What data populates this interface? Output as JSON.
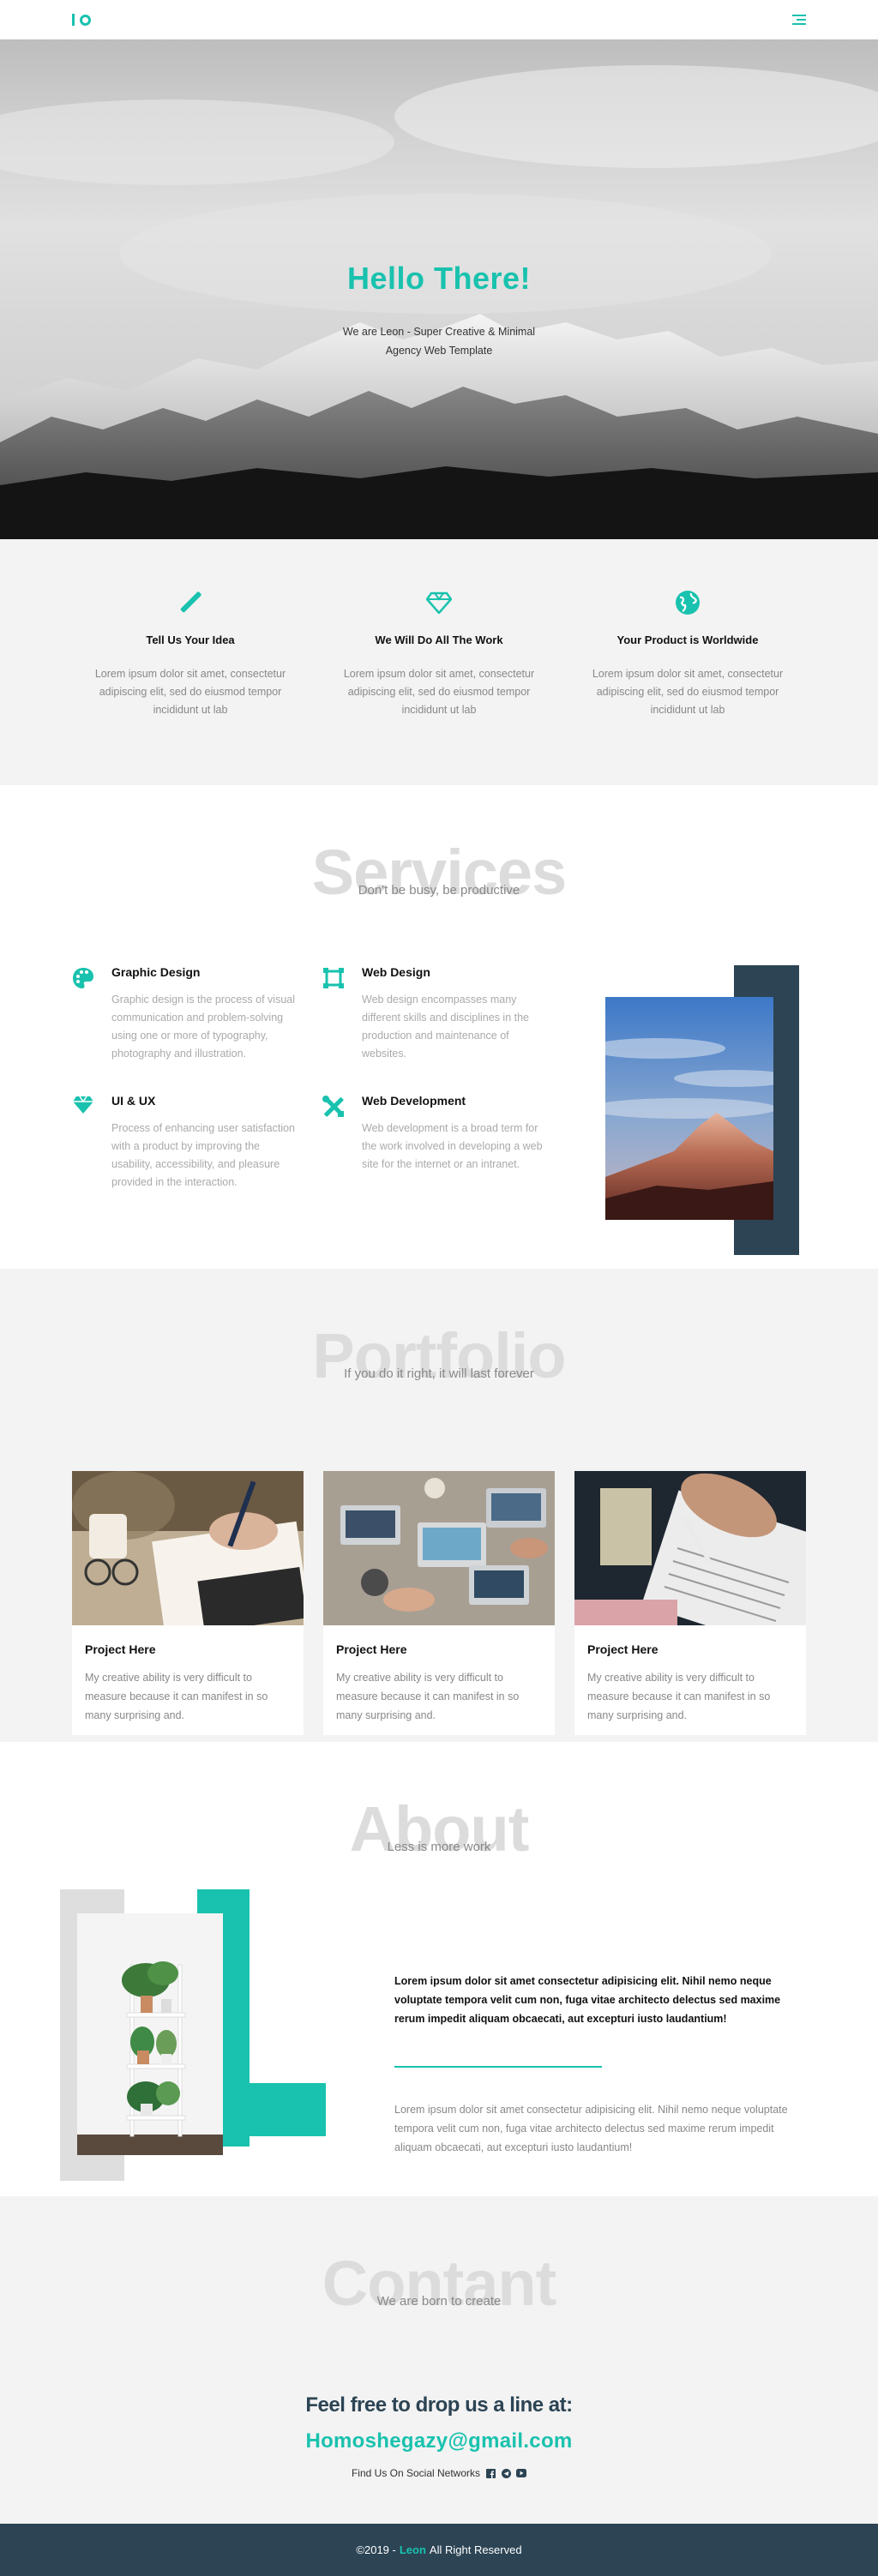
{
  "nav": {
    "logo_label": "IO"
  },
  "hero": {
    "title": "Hello There!",
    "subtitle": "We are Leon - Super Creative & Minimal Agency Web Template"
  },
  "features": [
    {
      "icon": "pen-icon",
      "title": "Tell Us Your Idea",
      "text": "Lorem ipsum dolor sit amet, consectetur adipiscing elit, sed do eiusmod tempor incididunt ut lab"
    },
    {
      "icon": "diamond-icon",
      "title": "We Will Do All The Work",
      "text": "Lorem ipsum dolor sit amet, consectetur adipiscing elit, sed do eiusmod tempor incididunt ut lab"
    },
    {
      "icon": "globe-icon",
      "title": "Your Product is Worldwide",
      "text": "Lorem ipsum dolor sit amet, consectetur adipiscing elit, sed do eiusmod tempor incididunt ut lab"
    }
  ],
  "services": {
    "heading": "Services",
    "subheading": "Don't be busy, be productive",
    "items": [
      {
        "icon": "palette-icon",
        "title": "Graphic Design",
        "text": "Graphic design is the process of visual communication and problem-solving using one or more of typography, photography and illustration."
      },
      {
        "icon": "crop-frame-icon",
        "title": "Web Design",
        "text": "Web design encompasses many different skills and disciplines in the production and maintenance of websites."
      },
      {
        "icon": "gem-icon",
        "title": "UI & UX",
        "text": "Process of enhancing user satisfaction with a product by improving the usability, accessibility, and pleasure provided in the interaction."
      },
      {
        "icon": "tools-icon",
        "title": "Web Development",
        "text": "Web development is a broad term for the work involved in developing a web site for the internet or an intranet."
      }
    ]
  },
  "portfolio": {
    "heading": "Portfolio",
    "subheading": "If you do it right, it will last forever",
    "cards": [
      {
        "title": "Project Here",
        "text": "My creative ability is very difficult to measure because it can manifest in so many surprising and."
      },
      {
        "title": "Project Here",
        "text": "My creative ability is very difficult to measure because it can manifest in so many surprising and."
      },
      {
        "title": "Project Here",
        "text": "My creative ability is very difficult to measure because it can manifest in so many surprising and."
      }
    ]
  },
  "about": {
    "heading": "About",
    "subheading": "Less is more work",
    "lead": "Lorem ipsum dolor sit amet consectetur adipisicing elit. Nihil nemo neque voluptate tempora velit cum non, fuga vitae architecto delectus sed maxime rerum impedit aliquam obcaecati, aut excepturi iusto laudantium!",
    "body": "Lorem ipsum dolor sit amet consectetur adipisicing elit. Nihil nemo neque voluptate tempora velit cum non, fuga vitae architecto delectus sed maxime rerum impedit aliquam obcaecati, aut excepturi iusto laudantium!"
  },
  "contact": {
    "heading": "Contant",
    "subheading": "We are born to create",
    "title": "Feel free to drop us a line at:",
    "email": "Homoshegazy@gmail.com",
    "social_label": "Find Us On Social Networks"
  },
  "footer": {
    "prefix": "©2019 -",
    "brand": "Leon",
    "suffix": "All Right Reserved"
  },
  "colors": {
    "accent": "#19c2ae",
    "dark": "#2c4454",
    "light_bg": "#f3f3f3"
  }
}
